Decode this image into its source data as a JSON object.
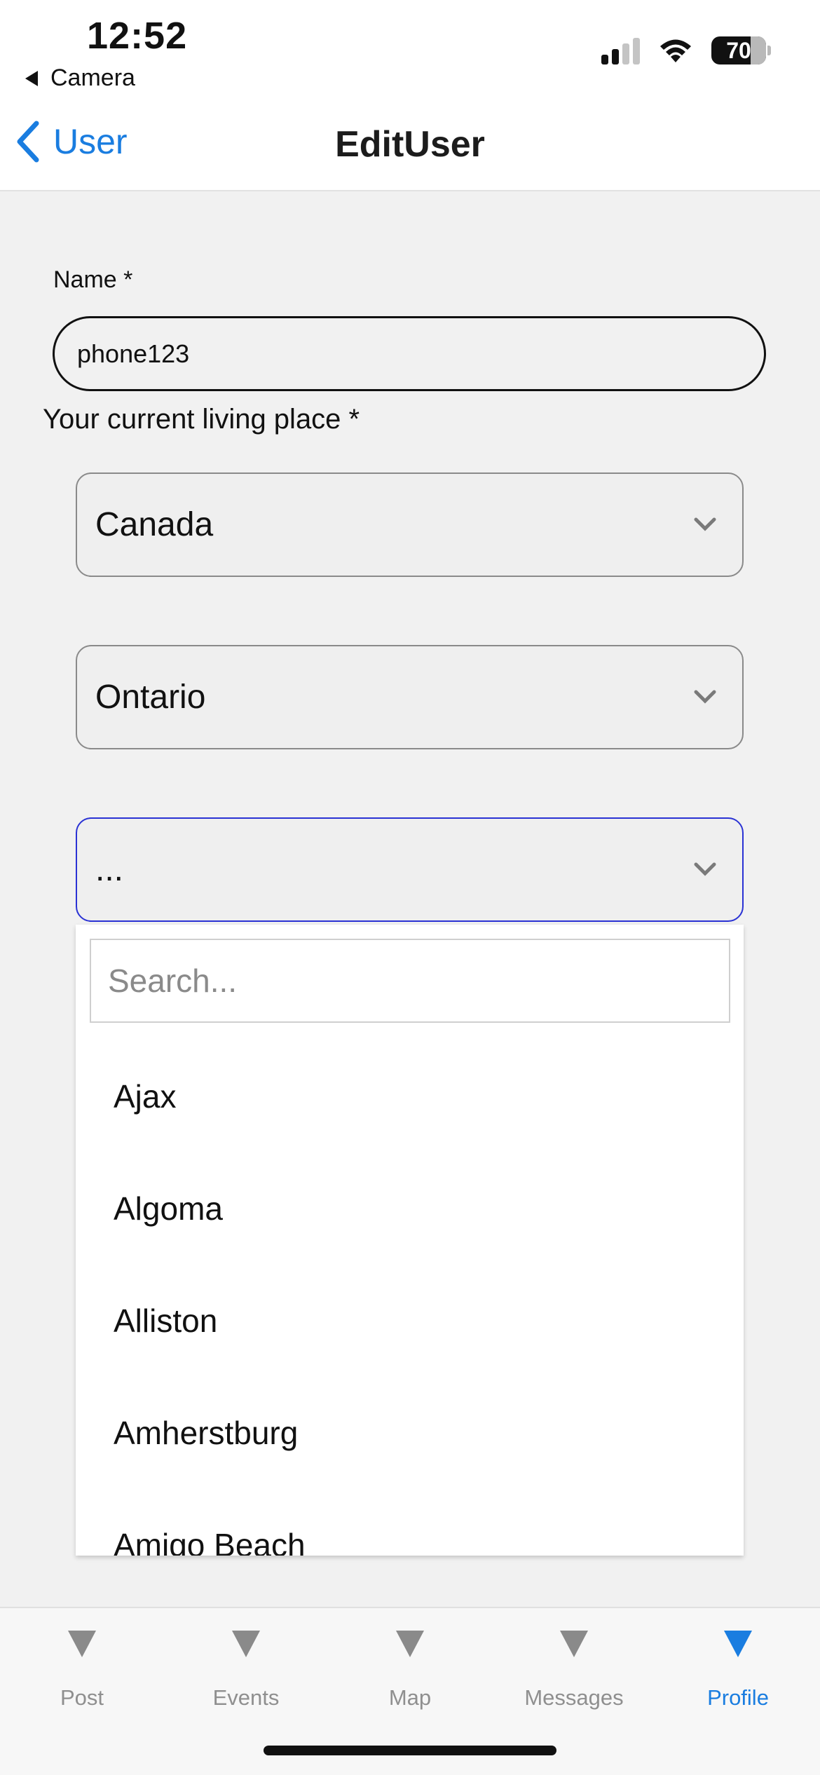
{
  "status_bar": {
    "time": "12:52",
    "back_app": "Camera",
    "battery": "70"
  },
  "nav": {
    "back_label": "User",
    "title": "EditUser"
  },
  "form": {
    "name_label": "Name *",
    "name_value": "phone123",
    "place_label": "Your current living place *",
    "country": "Canada",
    "province": "Ontario",
    "city": "..."
  },
  "dropdown": {
    "search_placeholder": "Search...",
    "options": [
      "Ajax",
      "Algoma",
      "Alliston",
      "Amherstburg",
      "Amigo Beach"
    ]
  },
  "tabbar": {
    "tabs": [
      {
        "label": "Post",
        "active": false
      },
      {
        "label": "Events",
        "active": false
      },
      {
        "label": "Map",
        "active": false
      },
      {
        "label": "Messages",
        "active": false
      },
      {
        "label": "Profile",
        "active": true
      }
    ]
  },
  "colors": {
    "accent": "#1a7de0",
    "focus_border": "#2a32d4",
    "background": "#f1f1f1"
  }
}
